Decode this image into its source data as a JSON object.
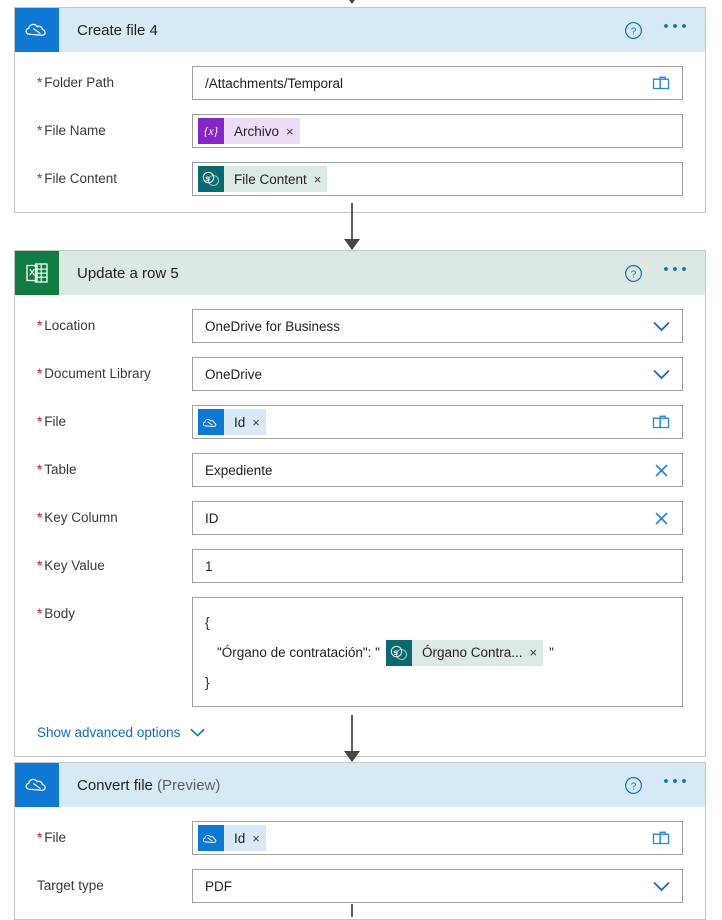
{
  "flow": {
    "connectors": [
      {
        "name": "connector-top",
        "style": "arrow-down"
      },
      {
        "name": "connector-create-to-update",
        "style": "arrow-down"
      },
      {
        "name": "connector-update-to-convert",
        "style": "arrow-down"
      },
      {
        "name": "connector-bottom",
        "style": "arrow-down"
      }
    ],
    "cards": [
      {
        "id": "create-file-4",
        "title": "Create file 4",
        "title_suffix": "",
        "connector": "onedrive",
        "icon": "onedrive-icon",
        "help_icon": "help-icon",
        "more_icon": "more-options-icon",
        "fields": [
          {
            "id": "folder-path",
            "label": "Folder Path",
            "required": true,
            "control": "text-with-picker",
            "value": "/Attachments/Temporal",
            "affordance": "folder-picker-icon"
          },
          {
            "id": "file-name",
            "label": "File Name",
            "required": true,
            "control": "token",
            "token": {
              "label": "Archivo",
              "icon": "expression-icon",
              "theme": "expr",
              "remove": "×"
            }
          },
          {
            "id": "file-content",
            "label": "File Content",
            "required": true,
            "control": "token",
            "token": {
              "label": "File Content",
              "icon": "sharepoint-icon",
              "theme": "sharepoint",
              "remove": "×"
            }
          }
        ]
      },
      {
        "id": "update-a-row-5",
        "title": "Update a row 5",
        "title_suffix": "",
        "connector": "excel",
        "icon": "excel-icon",
        "help_icon": "help-icon",
        "more_icon": "more-options-icon",
        "fields": [
          {
            "id": "location",
            "label": "Location",
            "required": true,
            "control": "dropdown",
            "value": "OneDrive for Business",
            "affordance": "chevron-down-icon"
          },
          {
            "id": "document-library",
            "label": "Document Library",
            "required": true,
            "control": "dropdown",
            "value": "OneDrive",
            "affordance": "chevron-down-icon"
          },
          {
            "id": "file",
            "label": "File",
            "required": true,
            "control": "token",
            "token": {
              "label": "Id",
              "icon": "onedrive-icon",
              "theme": "onedrive",
              "remove": "×"
            },
            "affordance": "folder-picker-icon"
          },
          {
            "id": "table",
            "label": "Table",
            "required": true,
            "control": "text-with-clear",
            "value": "Expediente",
            "affordance": "clear-icon"
          },
          {
            "id": "key-column",
            "label": "Key Column",
            "required": true,
            "control": "text-with-clear",
            "value": "ID",
            "affordance": "clear-icon"
          },
          {
            "id": "key-value",
            "label": "Key Value",
            "required": true,
            "control": "text",
            "value": "1",
            "affordance": ""
          },
          {
            "id": "body",
            "label": "Body",
            "required": true,
            "control": "json",
            "json_lines": [
              {
                "text": "{",
                "indent": false
              },
              {
                "text": "\"Órgano de contratación\": \"",
                "indent": true,
                "token": {
                  "label": "Órgano Contra...",
                  "icon": "sharepoint-icon",
                  "theme": "sharepoint",
                  "remove": "×"
                },
                "after": "\""
              },
              {
                "text": "}",
                "indent": false
              }
            ]
          }
        ],
        "advanced_options": {
          "label": "Show advanced options",
          "icon": "chevron-down-icon"
        }
      },
      {
        "id": "convert-file",
        "title": "Convert file",
        "title_suffix": "(Preview)",
        "connector": "onedrive",
        "icon": "onedrive-icon",
        "help_icon": "help-icon",
        "more_icon": "more-options-icon",
        "fields": [
          {
            "id": "convert-file-input",
            "label": "File",
            "required": true,
            "control": "token",
            "token": {
              "label": "Id",
              "icon": "onedrive-icon",
              "theme": "onedrive",
              "remove": "×"
            },
            "affordance": "folder-picker-icon"
          },
          {
            "id": "target-type",
            "label": "Target type",
            "required": false,
            "control": "dropdown",
            "value": "PDF",
            "affordance": "chevron-down-icon"
          }
        ]
      }
    ]
  },
  "colors": {
    "onedrive_blue": "#0f78d4",
    "onedrive_header": "#d6e9f7",
    "excel_green": "#107c41",
    "excel_header": "#dbe9e2",
    "accent_link": "#0f6cbd",
    "required_red": "#e81123",
    "border": "#a19f9d",
    "token_expr": "#8527c4",
    "token_sharepoint": "#0b6a6f"
  }
}
